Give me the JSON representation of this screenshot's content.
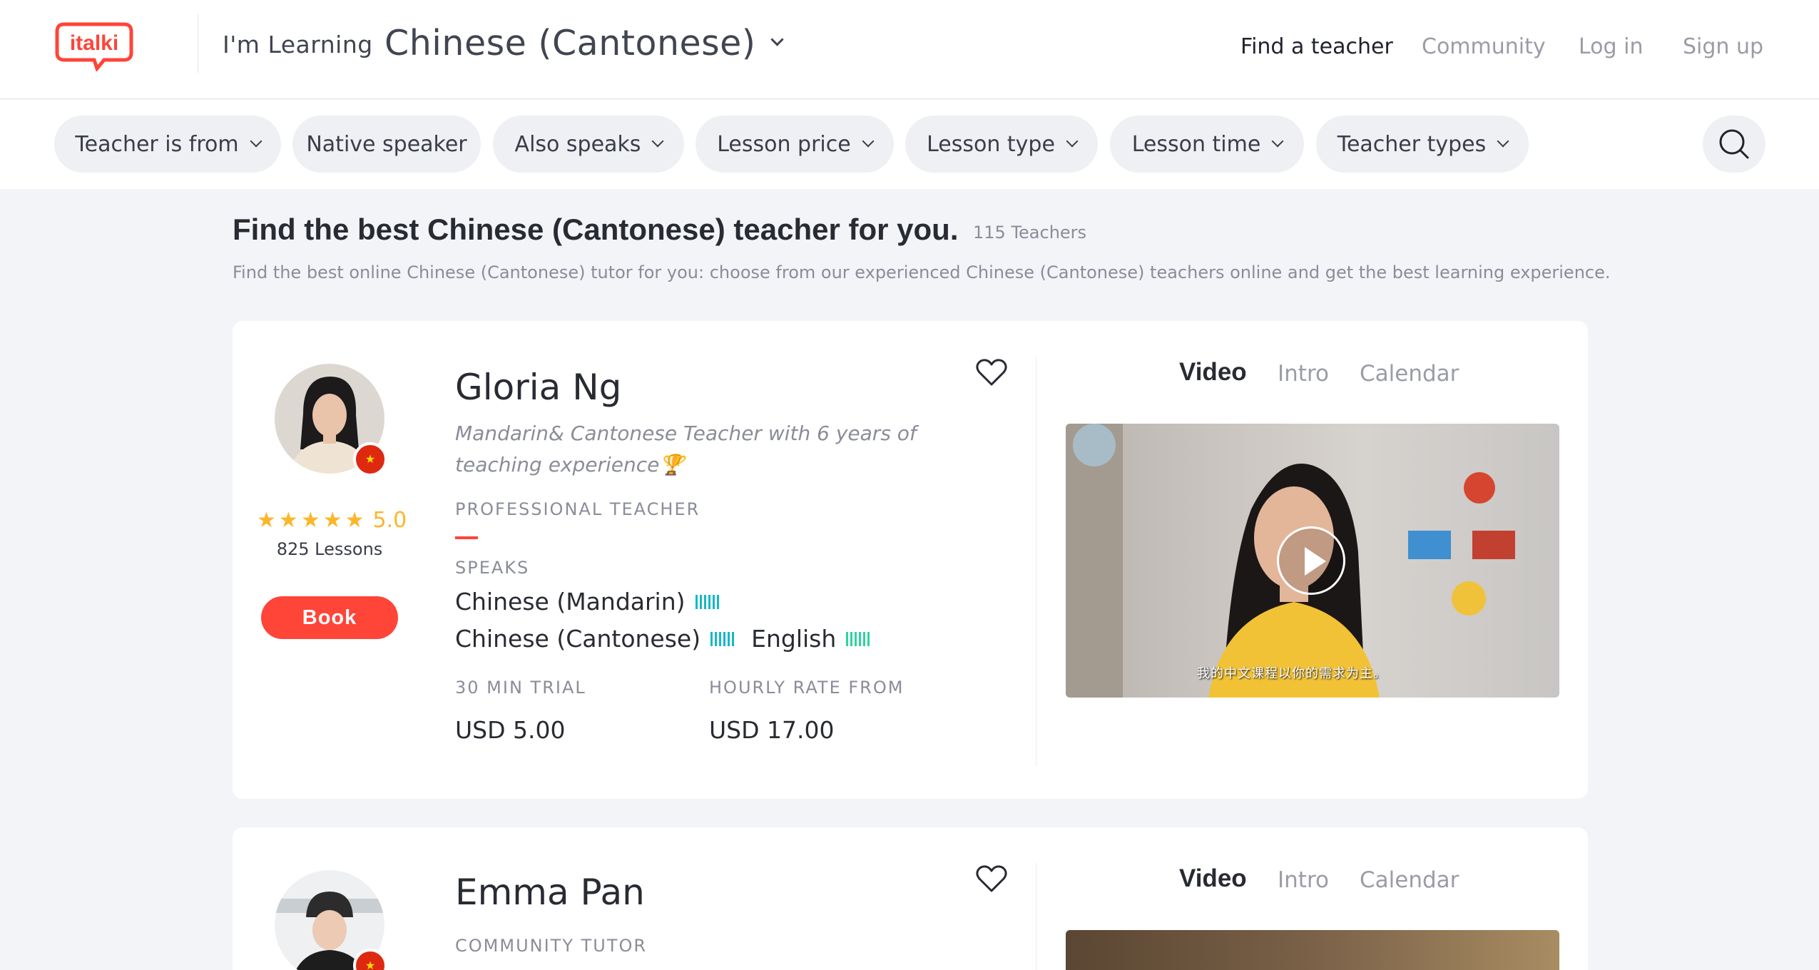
{
  "header": {
    "logo_text": "italki",
    "learning_label": "I'm Learning",
    "learning_language": "Chinese (Cantonese)",
    "nav": {
      "find_teacher": "Find a teacher",
      "community": "Community",
      "login": "Log in",
      "signup": "Sign up"
    }
  },
  "filters": [
    {
      "label": "Teacher is from",
      "dropdown": true
    },
    {
      "label": "Native speaker",
      "dropdown": false
    },
    {
      "label": "Also speaks",
      "dropdown": true
    },
    {
      "label": "Lesson price",
      "dropdown": true
    },
    {
      "label": "Lesson type",
      "dropdown": true
    },
    {
      "label": "Lesson time",
      "dropdown": true
    },
    {
      "label": "Teacher types",
      "dropdown": true
    }
  ],
  "main": {
    "headline": "Find the best Chinese (Cantonese) teacher for you.",
    "count": "115 Teachers",
    "subline": "Find the best online Chinese (Cantonese) tutor for you: choose from our experienced Chinese (Cantonese) teachers online and get the best learning experience."
  },
  "teachers": [
    {
      "name": "Gloria Ng",
      "tagline": "Mandarin& Cantonese Teacher with 6 years of teaching experience🏆",
      "type": "PROFESSIONAL TEACHER",
      "rating": "5.0",
      "lessons": "825 Lessons",
      "book_label": "Book",
      "speaks_label": "SPEAKS",
      "languages": [
        {
          "name": "Chinese (Mandarin)",
          "level_color": "#14b8c7"
        },
        {
          "name": "Chinese (Cantonese)",
          "level_color": "#14b8c7"
        },
        {
          "name": "English",
          "level_color": "#2fd3a0"
        }
      ],
      "trial_label": "30 MIN TRIAL",
      "trial_price": "USD 5.00",
      "hourly_label": "HOURLY RATE FROM",
      "hourly_price": "USD 17.00",
      "media_tabs": [
        "Video",
        "Intro",
        "Calendar"
      ],
      "video_subtitle": "我的中文课程以你的需求为主。"
    },
    {
      "name": "Emma Pan",
      "type": "COMMUNITY TUTOR",
      "media_tabs": [
        "Video",
        "Intro",
        "Calendar"
      ]
    }
  ],
  "colors": {
    "accent_red": "#ff4438",
    "star": "#fcb62b",
    "page_bg": "#f3f4f8"
  }
}
